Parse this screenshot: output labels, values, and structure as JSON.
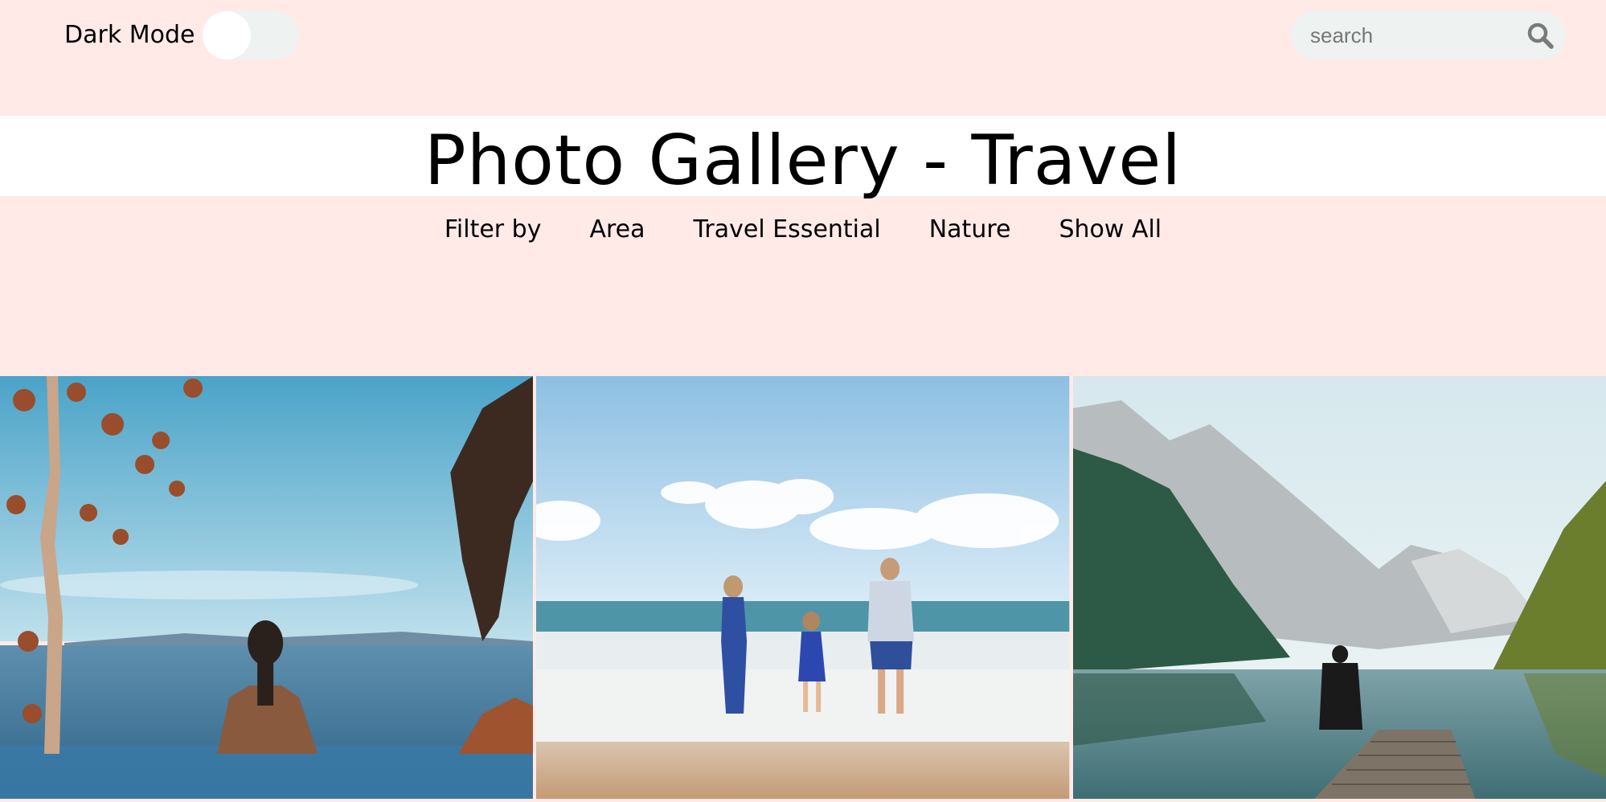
{
  "header": {
    "dark_mode_label": "Dark Mode",
    "dark_mode_on": false,
    "search_placeholder": "search"
  },
  "title": "Photo Gallery - Travel",
  "filters": {
    "label": "Filter by",
    "options": [
      "Area",
      "Travel Essential",
      "Nature",
      "Show All"
    ]
  },
  "gallery": {
    "photos": [
      {
        "subject": "woman-infinity-pool-ocean"
      },
      {
        "subject": "family-beach-waves"
      },
      {
        "subject": "person-dock-mountain-lake"
      }
    ]
  },
  "colors": {
    "background": "#ffeae8",
    "title_band": "#ffffff",
    "control_bg": "#eef2f1"
  }
}
